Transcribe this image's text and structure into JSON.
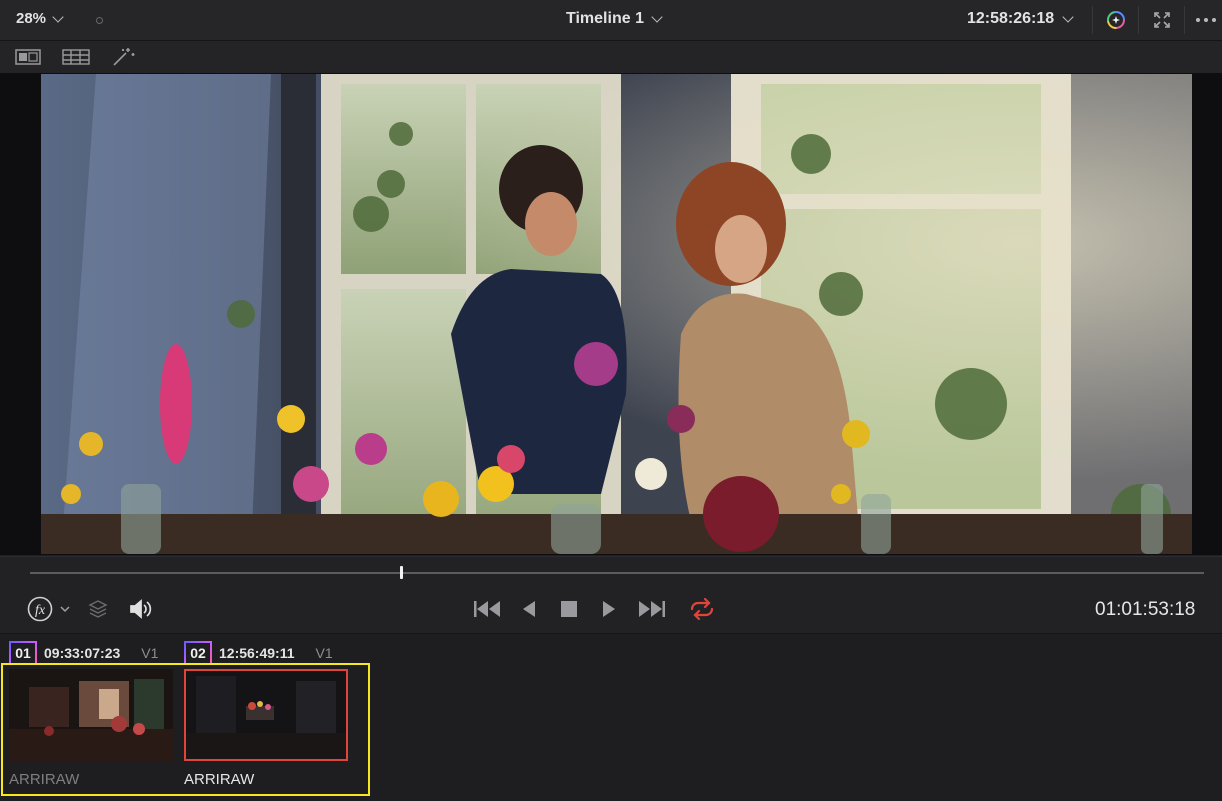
{
  "header": {
    "zoom_label": "28%",
    "timeline_name": "Timeline 1",
    "timecode": "12:58:26:18"
  },
  "transport": {
    "current_timecode": "01:01:53:18"
  },
  "clips": [
    {
      "number": "01",
      "timecode": "09:33:07:23",
      "track": "V1",
      "codec": "ARRIRAW",
      "selected": false
    },
    {
      "number": "02",
      "timecode": "12:56:49:11",
      "track": "V1",
      "codec": "ARRIRAW",
      "selected": true
    }
  ],
  "colors": {
    "accent_red": "#e0443a",
    "selection_outline": "#f5e81f",
    "background": "#1f1f22"
  },
  "icons": [
    "chevron-down-icon",
    "color-wheel-icon",
    "fullscreen-icon",
    "more-icon",
    "dual-viewer-icon",
    "grid-view-icon",
    "magic-wand-icon",
    "fx-icon",
    "layers-icon",
    "speaker-icon",
    "jump-to-start-icon",
    "reverse-play-icon",
    "stop-icon",
    "play-icon",
    "jump-to-end-icon",
    "loop-icon"
  ]
}
